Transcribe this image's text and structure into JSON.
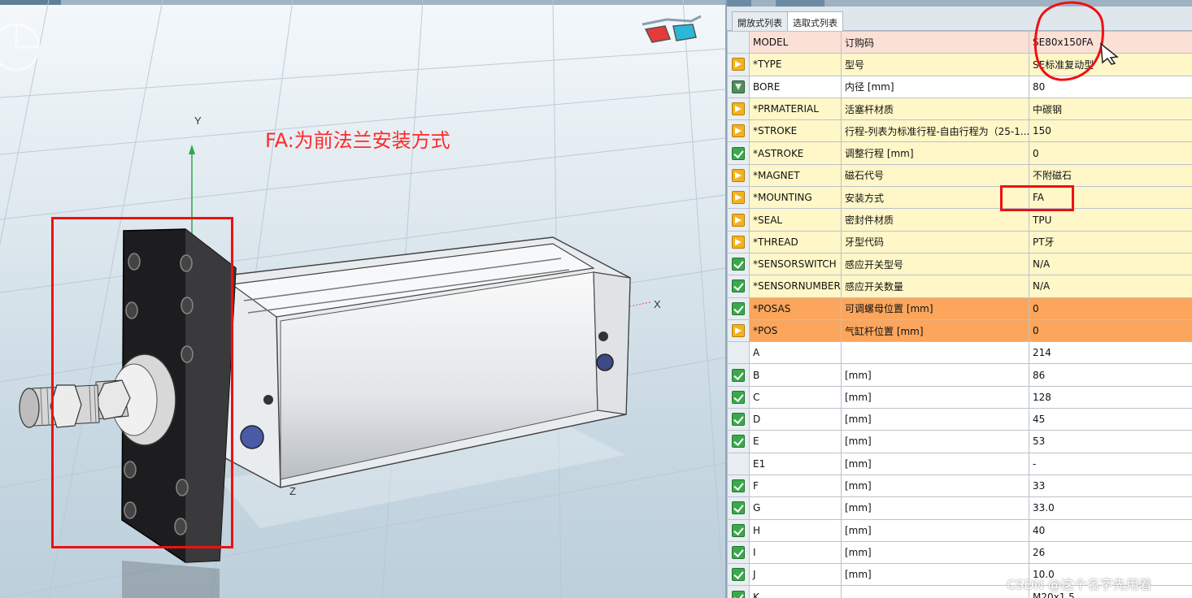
{
  "viewport": {
    "annotation": "FA:为前法兰安装方式",
    "axis_x": "X",
    "axis_y": "Y",
    "axis_z": "Z"
  },
  "panel": {
    "tabs": [
      {
        "label": "開放式列表"
      },
      {
        "label": "选取式列表"
      }
    ],
    "rows": [
      {
        "icon": "none",
        "color": "pink",
        "name": "MODEL",
        "desc": "订购码",
        "value": "SE80x150FA"
      },
      {
        "icon": "arrow",
        "color": "yellow",
        "name": "*TYPE",
        "desc": "型号",
        "value": "SE标准复动型"
      },
      {
        "icon": "filter",
        "color": "white",
        "name": "BORE",
        "desc": "内径 [mm]",
        "value": "80"
      },
      {
        "icon": "arrow",
        "color": "yellow",
        "name": "*PRMATERIAL",
        "desc": "活塞杆材质",
        "value": "中碳钢"
      },
      {
        "icon": "arrow",
        "color": "yellow",
        "name": "*STROKE",
        "desc": "行程-列表为标准行程-自由行程为（25-1...",
        "value": "150"
      },
      {
        "icon": "check",
        "color": "yellow",
        "name": "*ASTROKE",
        "desc": "调整行程 [mm]",
        "value": "0"
      },
      {
        "icon": "arrow",
        "color": "yellow",
        "name": "*MAGNET",
        "desc": "磁石代号",
        "value": "不附磁石"
      },
      {
        "icon": "arrow",
        "color": "yellow",
        "name": "*MOUNTING",
        "desc": "安装方式",
        "value": "FA"
      },
      {
        "icon": "arrow",
        "color": "yellow",
        "name": "*SEAL",
        "desc": "密封件材质",
        "value": "TPU"
      },
      {
        "icon": "arrow",
        "color": "yellow",
        "name": "*THREAD",
        "desc": "牙型代码",
        "value": "PT牙"
      },
      {
        "icon": "check",
        "color": "yellow",
        "name": "*SENSORSWITCH",
        "desc": "感应开关型号",
        "value": "N/A"
      },
      {
        "icon": "check",
        "color": "yellow",
        "name": "*SENSORNUMBER",
        "desc": "感应开关数量",
        "value": "N/A"
      },
      {
        "icon": "check",
        "color": "orange",
        "name": "*POSAS",
        "desc": "可调螺母位置 [mm]",
        "value": "0"
      },
      {
        "icon": "arrow",
        "color": "orange",
        "name": "*POS",
        "desc": "气缸杆位置 [mm]",
        "value": "0"
      },
      {
        "icon": "none",
        "color": "white",
        "name": "A",
        "desc": "",
        "value": "214"
      },
      {
        "icon": "check",
        "color": "white",
        "name": "B",
        "desc": "[mm]",
        "value": "86"
      },
      {
        "icon": "check",
        "color": "white",
        "name": "C",
        "desc": "[mm]",
        "value": "128"
      },
      {
        "icon": "check",
        "color": "white",
        "name": "D",
        "desc": "[mm]",
        "value": "45"
      },
      {
        "icon": "check",
        "color": "white",
        "name": "E",
        "desc": "[mm]",
        "value": "53"
      },
      {
        "icon": "none",
        "color": "white",
        "name": "E1",
        "desc": "[mm]",
        "value": "-"
      },
      {
        "icon": "check",
        "color": "white",
        "name": "F",
        "desc": "[mm]",
        "value": "33"
      },
      {
        "icon": "check",
        "color": "white",
        "name": "G",
        "desc": "[mm]",
        "value": "33.0"
      },
      {
        "icon": "check",
        "color": "white",
        "name": "H",
        "desc": "[mm]",
        "value": "40"
      },
      {
        "icon": "check",
        "color": "white",
        "name": "I",
        "desc": "[mm]",
        "value": "26"
      },
      {
        "icon": "check",
        "color": "white",
        "name": "J",
        "desc": "[mm]",
        "value": "10.0"
      },
      {
        "icon": "check",
        "color": "white",
        "name": "K",
        "desc": "",
        "value": "M20x1.5"
      }
    ]
  },
  "watermark": "CSDN @这个名字先用着"
}
